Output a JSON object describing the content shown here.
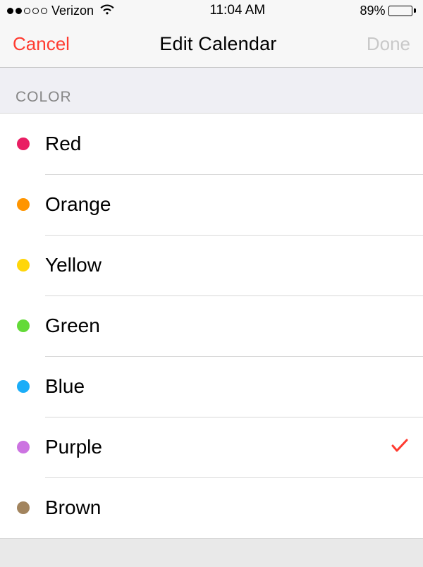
{
  "status": {
    "signal_filled": 2,
    "signal_total": 5,
    "carrier": "Verizon",
    "time": "11:04 AM",
    "battery_pct": "89%",
    "battery_fill": 89
  },
  "nav": {
    "cancel": "Cancel",
    "title": "Edit Calendar",
    "done": "Done"
  },
  "section": {
    "header": "COLOR"
  },
  "colors": [
    {
      "label": "Red",
      "hex": "#e91e63",
      "selected": false
    },
    {
      "label": "Orange",
      "hex": "#ff9500",
      "selected": false
    },
    {
      "label": "Yellow",
      "hex": "#ffd60a",
      "selected": false
    },
    {
      "label": "Green",
      "hex": "#63da38",
      "selected": false
    },
    {
      "label": "Blue",
      "hex": "#1badf8",
      "selected": false
    },
    {
      "label": "Purple",
      "hex": "#cc73e1",
      "selected": true
    },
    {
      "label": "Brown",
      "hex": "#a2845e",
      "selected": false
    }
  ],
  "accent": "#ff3b30"
}
